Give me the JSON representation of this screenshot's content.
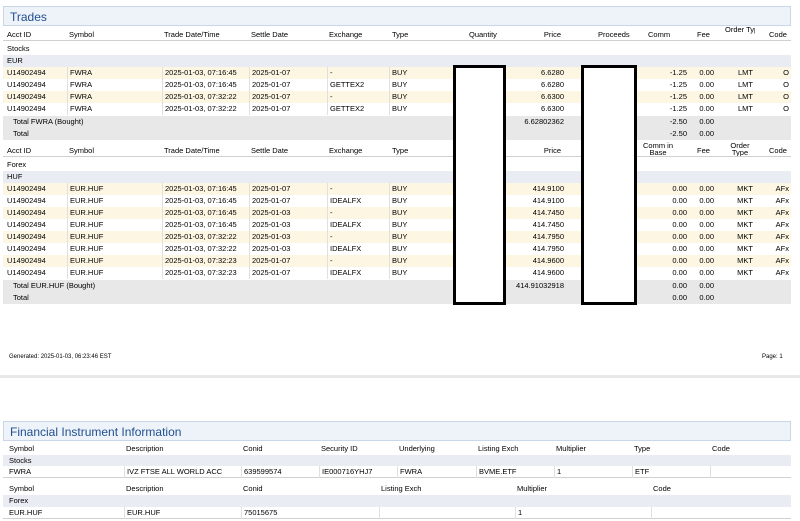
{
  "trades": {
    "title": "Trades",
    "header1": [
      "Acct ID",
      "Symbol",
      "Trade Date/Time",
      "Settle Date",
      "Exchange",
      "Type",
      "Quantity",
      "Price",
      "Proceeds",
      "Comm",
      "Fee",
      "Order Type",
      "Code"
    ],
    "stocks_label": "Stocks",
    "eur_label": "EUR",
    "stock_rows": [
      [
        "U14902494",
        "FWRA",
        "2025-01-03, 07:16:45",
        "2025-01-07",
        "-",
        "BUY",
        "6.6280",
        "-1.25",
        "0.00",
        "LMT",
        "O"
      ],
      [
        "U14902494",
        "FWRA",
        "2025-01-03, 07:16:45",
        "2025-01-07",
        "GETTEX2",
        "BUY",
        "6.6280",
        "-1.25",
        "0.00",
        "LMT",
        "O"
      ],
      [
        "U14902494",
        "FWRA",
        "2025-01-03, 07:32:22",
        "2025-01-07",
        "-",
        "BUY",
        "6.6300",
        "-1.25",
        "0.00",
        "LMT",
        "O"
      ],
      [
        "U14902494",
        "FWRA",
        "2025-01-03, 07:32:22",
        "2025-01-07",
        "GETTEX2",
        "BUY",
        "6.6300",
        "-1.25",
        "0.00",
        "LMT",
        "O"
      ]
    ],
    "stock_total": {
      "label": "Total FWRA (Bought)",
      "price": "6.62802362",
      "comm": "-2.50",
      "fee": "0.00"
    },
    "stock_total2": {
      "label": "Total",
      "comm": "-2.50",
      "fee": "0.00"
    },
    "header2": [
      "Acct ID",
      "Symbol",
      "Trade Date/Time",
      "Settle Date",
      "Exchange",
      "Type",
      "Price",
      "Comm in Base",
      "Fee",
      "Order Type",
      "Code"
    ],
    "forex_label": "Forex",
    "huf_label": "HUF",
    "forex_rows": [
      [
        "U14902494",
        "EUR.HUF",
        "2025-01-03, 07:16:45",
        "2025-01-07",
        "-",
        "BUY",
        "414.9100",
        "0.00",
        "0.00",
        "MKT",
        "AFx"
      ],
      [
        "U14902494",
        "EUR.HUF",
        "2025-01-03, 07:16:45",
        "2025-01-07",
        "IDEALFX",
        "BUY",
        "414.9100",
        "0.00",
        "0.00",
        "MKT",
        "AFx"
      ],
      [
        "U14902494",
        "EUR.HUF",
        "2025-01-03, 07:16:45",
        "2025-01-03",
        "-",
        "BUY",
        "414.7450",
        "0.00",
        "0.00",
        "MKT",
        "AFx"
      ],
      [
        "U14902494",
        "EUR.HUF",
        "2025-01-03, 07:16:45",
        "2025-01-03",
        "IDEALFX",
        "BUY",
        "414.7450",
        "0.00",
        "0.00",
        "MKT",
        "AFx"
      ],
      [
        "U14902494",
        "EUR.HUF",
        "2025-01-03, 07:32:22",
        "2025-01-03",
        "-",
        "BUY",
        "414.7950",
        "0.00",
        "0.00",
        "MKT",
        "AFx"
      ],
      [
        "U14902494",
        "EUR.HUF",
        "2025-01-03, 07:32:22",
        "2025-01-03",
        "IDEALFX",
        "BUY",
        "414.7950",
        "0.00",
        "0.00",
        "MKT",
        "AFx"
      ],
      [
        "U14902494",
        "EUR.HUF",
        "2025-01-03, 07:32:23",
        "2025-01-07",
        "-",
        "BUY",
        "414.9600",
        "0.00",
        "0.00",
        "MKT",
        "AFx"
      ],
      [
        "U14902494",
        "EUR.HUF",
        "2025-01-03, 07:32:23",
        "2025-01-07",
        "IDEALFX",
        "BUY",
        "414.9600",
        "0.00",
        "0.00",
        "MKT",
        "AFx"
      ]
    ],
    "forex_total": {
      "label": "Total EUR.HUF (Bought)",
      "price": "414.91032918",
      "comm": "0.00",
      "fee": "0.00"
    },
    "forex_total2": {
      "label": "Total",
      "comm": "0.00",
      "fee": "0.00"
    }
  },
  "footer": {
    "generated": "Generated: 2025-01-03, 06:23:46 EST",
    "page": "Page: 1"
  },
  "fin": {
    "title": "Financial Instrument Information",
    "header1": [
      "Symbol",
      "Description",
      "Conid",
      "Security ID",
      "Underlying",
      "Listing Exch",
      "Multiplier",
      "Type",
      "Code"
    ],
    "stocks_label": "Stocks",
    "stock_row": [
      "FWRA",
      "IVZ FTSE ALL WORLD ACC",
      "639599574",
      "IE000716YHJ7",
      "FWRA",
      "BVME.ETF",
      "1",
      "ETF",
      ""
    ],
    "header2": [
      "Symbol",
      "Description",
      "Conid",
      "Listing Exch",
      "Multiplier",
      "Code"
    ],
    "forex_label": "Forex",
    "forex_row": [
      "EUR.HUF",
      "EUR.HUF",
      "75015675",
      "",
      "1",
      ""
    ]
  }
}
